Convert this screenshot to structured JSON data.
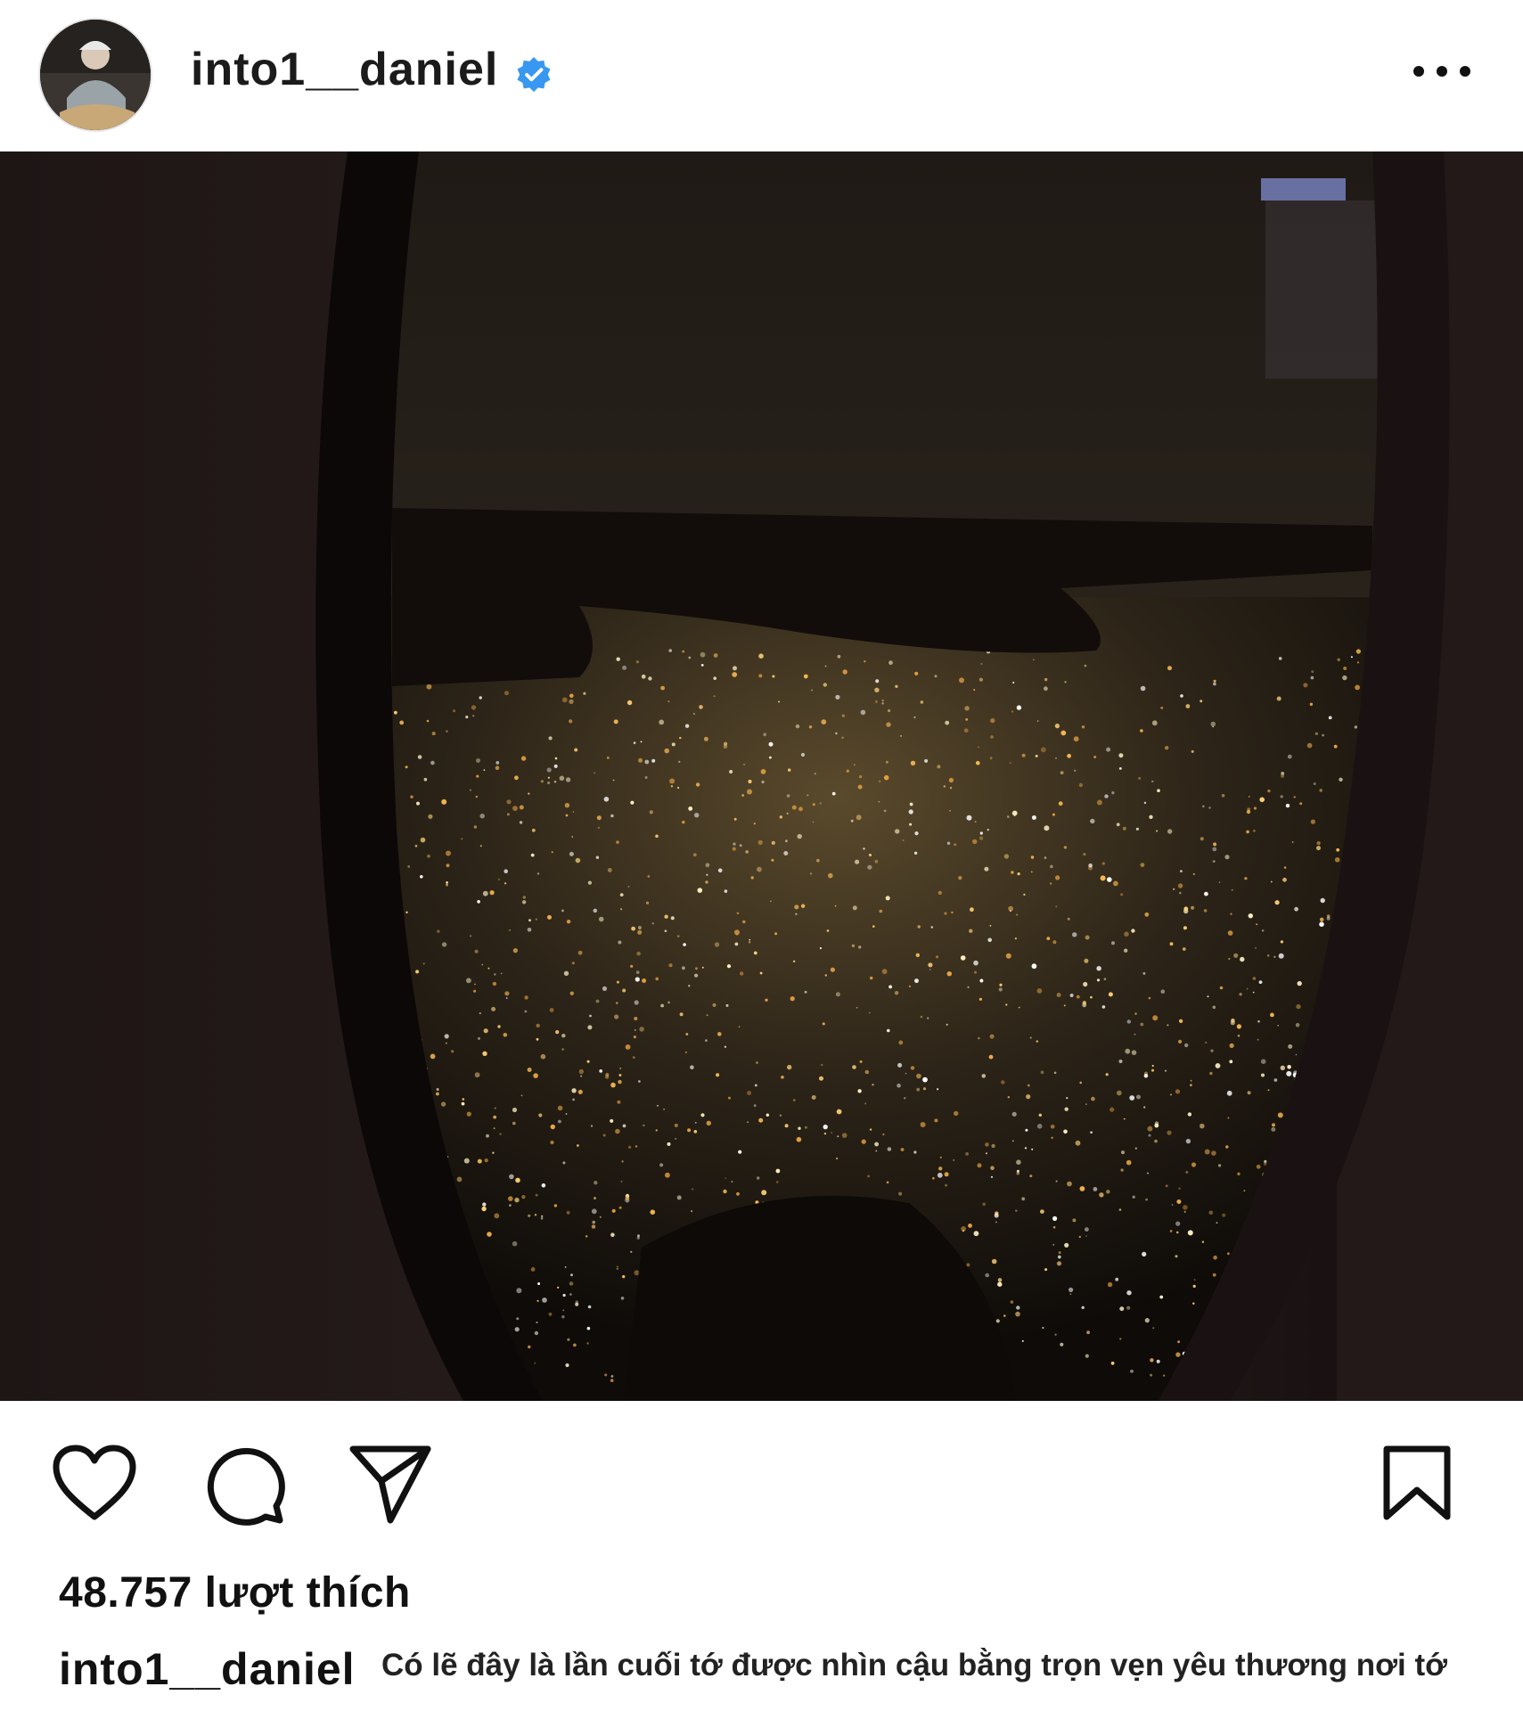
{
  "post": {
    "username": "into1__daniel",
    "verified": true,
    "likes_text": "48.757 lượt thích",
    "caption_username": "into1__daniel",
    "caption_text": "Có lẽ đây là lần cuối tớ được nhìn cậu bằng trọn vẹn yêu thương nơi tớ"
  },
  "icons": {
    "more": "more-options-icon",
    "like": "heart-icon",
    "comment": "comment-icon",
    "share": "send-icon",
    "save": "bookmark-icon",
    "verified": "verified-badge-icon"
  },
  "colors": {
    "verified_blue": "#3897f0",
    "text": "#111111",
    "background": "#ffffff"
  }
}
